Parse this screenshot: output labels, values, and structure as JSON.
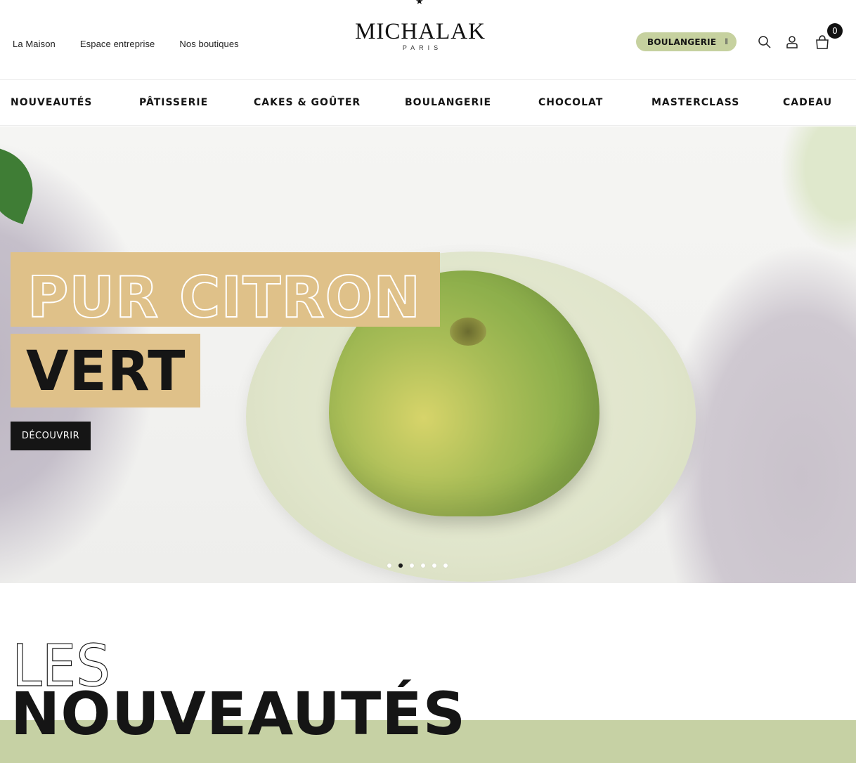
{
  "header": {
    "top_links": [
      {
        "label": "La Maison"
      },
      {
        "label": "Espace entreprise"
      },
      {
        "label": "Nos boutiques"
      }
    ],
    "logo": {
      "name": "MICHALAK",
      "city": "PARIS"
    },
    "mode_pill": {
      "label": "BOULANGERIE",
      "icon": "toggle-icon"
    },
    "icons": [
      "search-icon",
      "account-icon",
      "cart-icon"
    ],
    "cart_count": "0"
  },
  "menu": {
    "items": [
      {
        "label": "NOUVEAUTÉS"
      },
      {
        "label": "PÂTISSERIE"
      },
      {
        "label": "CAKES & GOÛTER"
      },
      {
        "label": "BOULANGERIE"
      },
      {
        "label": "CHOCOLAT"
      },
      {
        "label": "MASTERCLASS"
      },
      {
        "label": "CADEAU"
      }
    ]
  },
  "hero": {
    "title_outline": "PUR CITRON",
    "title_solid": "VERT",
    "cta_label": "DÉCOUVRIR",
    "slides_total": 6,
    "active_slide": 2,
    "colors": {
      "title_bg": "#dfc189",
      "cta_bg": "#151515"
    }
  },
  "section": {
    "title_outline": "LES",
    "title_solid": "NOUVEAUTÉS",
    "band_color": "#c6d1a4"
  }
}
